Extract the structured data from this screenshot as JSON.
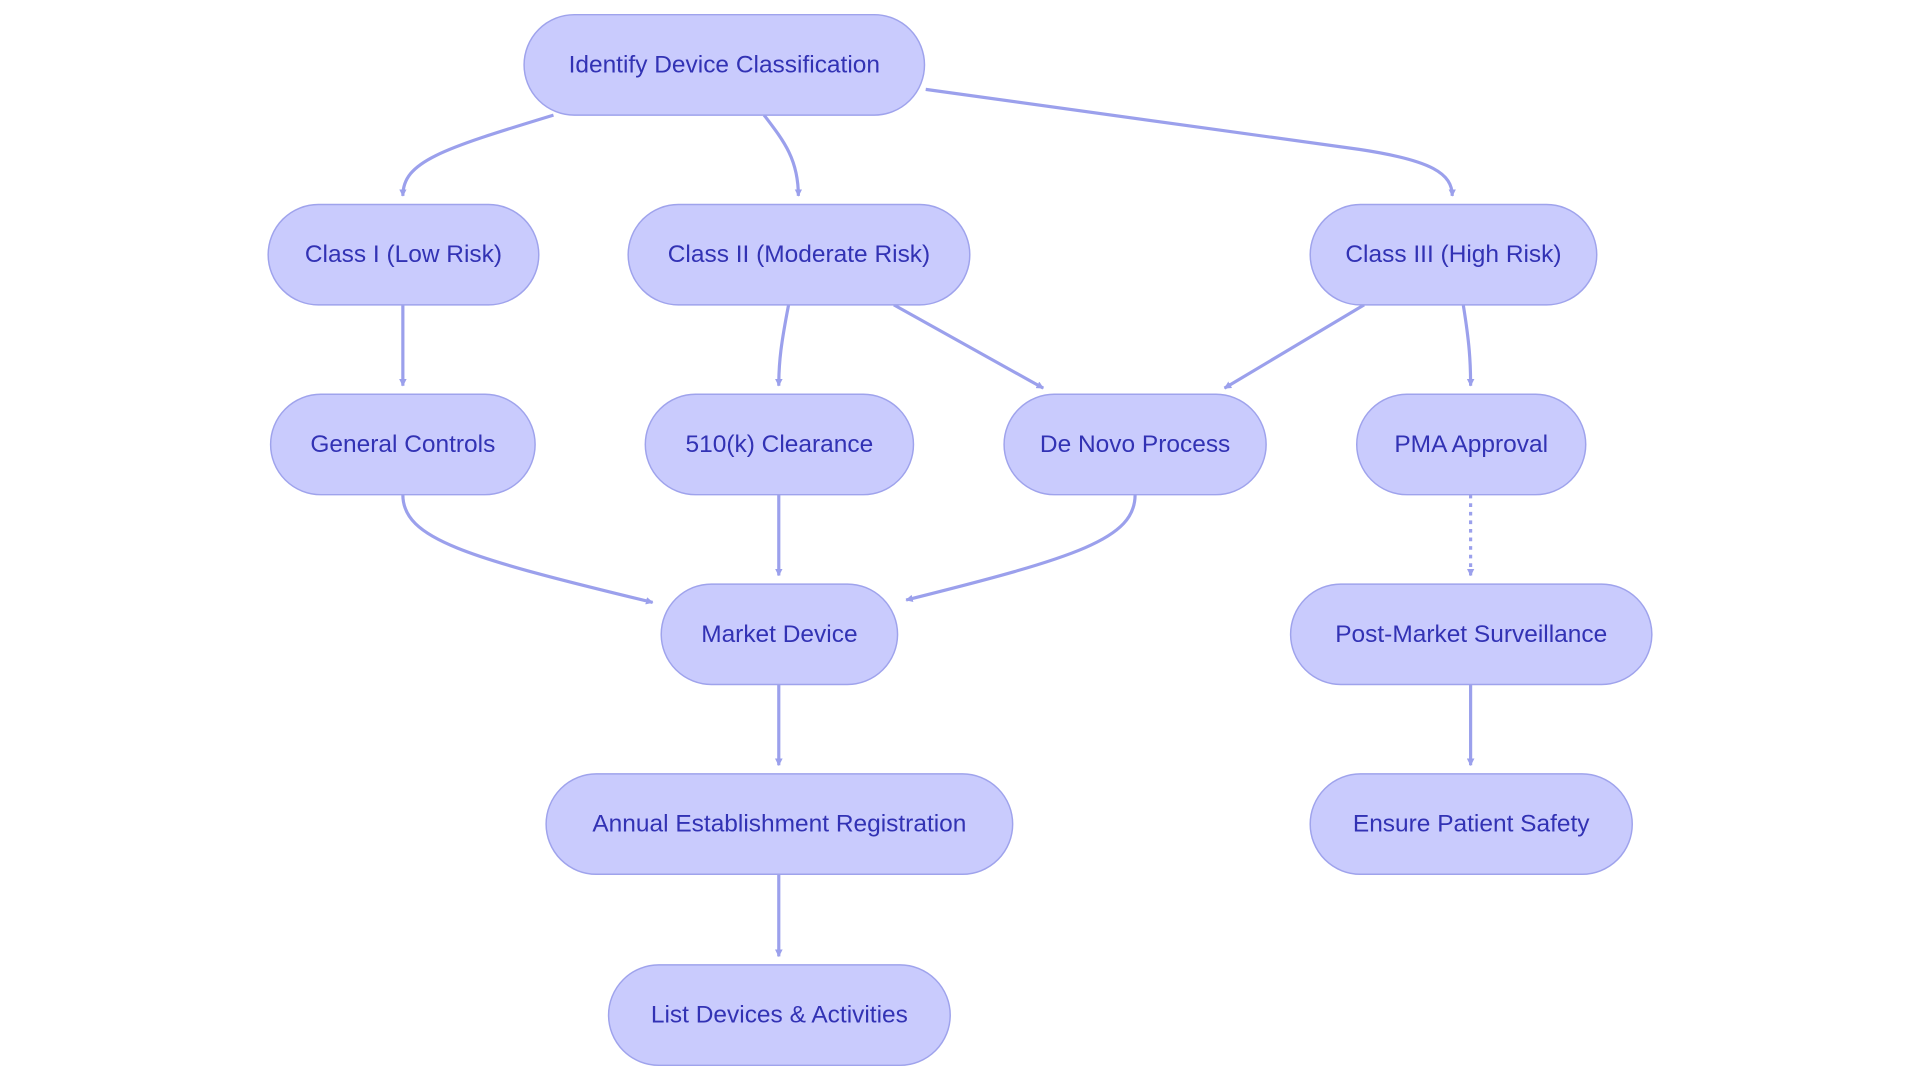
{
  "colors": {
    "node_fill": "#c9cbfd",
    "node_border": "#9fa3ec",
    "edge": "#9ba0ec",
    "text": "#3232b4"
  },
  "nodes": {
    "identify": "Identify Device Classification",
    "class1": "Class I (Low Risk)",
    "class2": "Class II (Moderate Risk)",
    "class3": "Class III (High Risk)",
    "general": "General Controls",
    "clearance": "510(k) Clearance",
    "denovo": "De Novo Process",
    "pma": "PMA Approval",
    "market": "Market Device",
    "postmarket": "Post-Market Surveillance",
    "annual": "Annual Establishment Registration",
    "safety": "Ensure Patient Safety",
    "list": "List Devices & Activities"
  },
  "edges": [
    {
      "from": "identify",
      "to": "class1"
    },
    {
      "from": "identify",
      "to": "class2"
    },
    {
      "from": "identify",
      "to": "class3"
    },
    {
      "from": "class1",
      "to": "general"
    },
    {
      "from": "class2",
      "to": "clearance"
    },
    {
      "from": "class2",
      "to": "denovo"
    },
    {
      "from": "class3",
      "to": "denovo"
    },
    {
      "from": "class3",
      "to": "pma"
    },
    {
      "from": "general",
      "to": "market"
    },
    {
      "from": "clearance",
      "to": "market"
    },
    {
      "from": "denovo",
      "to": "market"
    },
    {
      "from": "pma",
      "to": "postmarket",
      "style": "dotted"
    },
    {
      "from": "market",
      "to": "annual"
    },
    {
      "from": "postmarket",
      "to": "safety"
    },
    {
      "from": "annual",
      "to": "list"
    }
  ]
}
